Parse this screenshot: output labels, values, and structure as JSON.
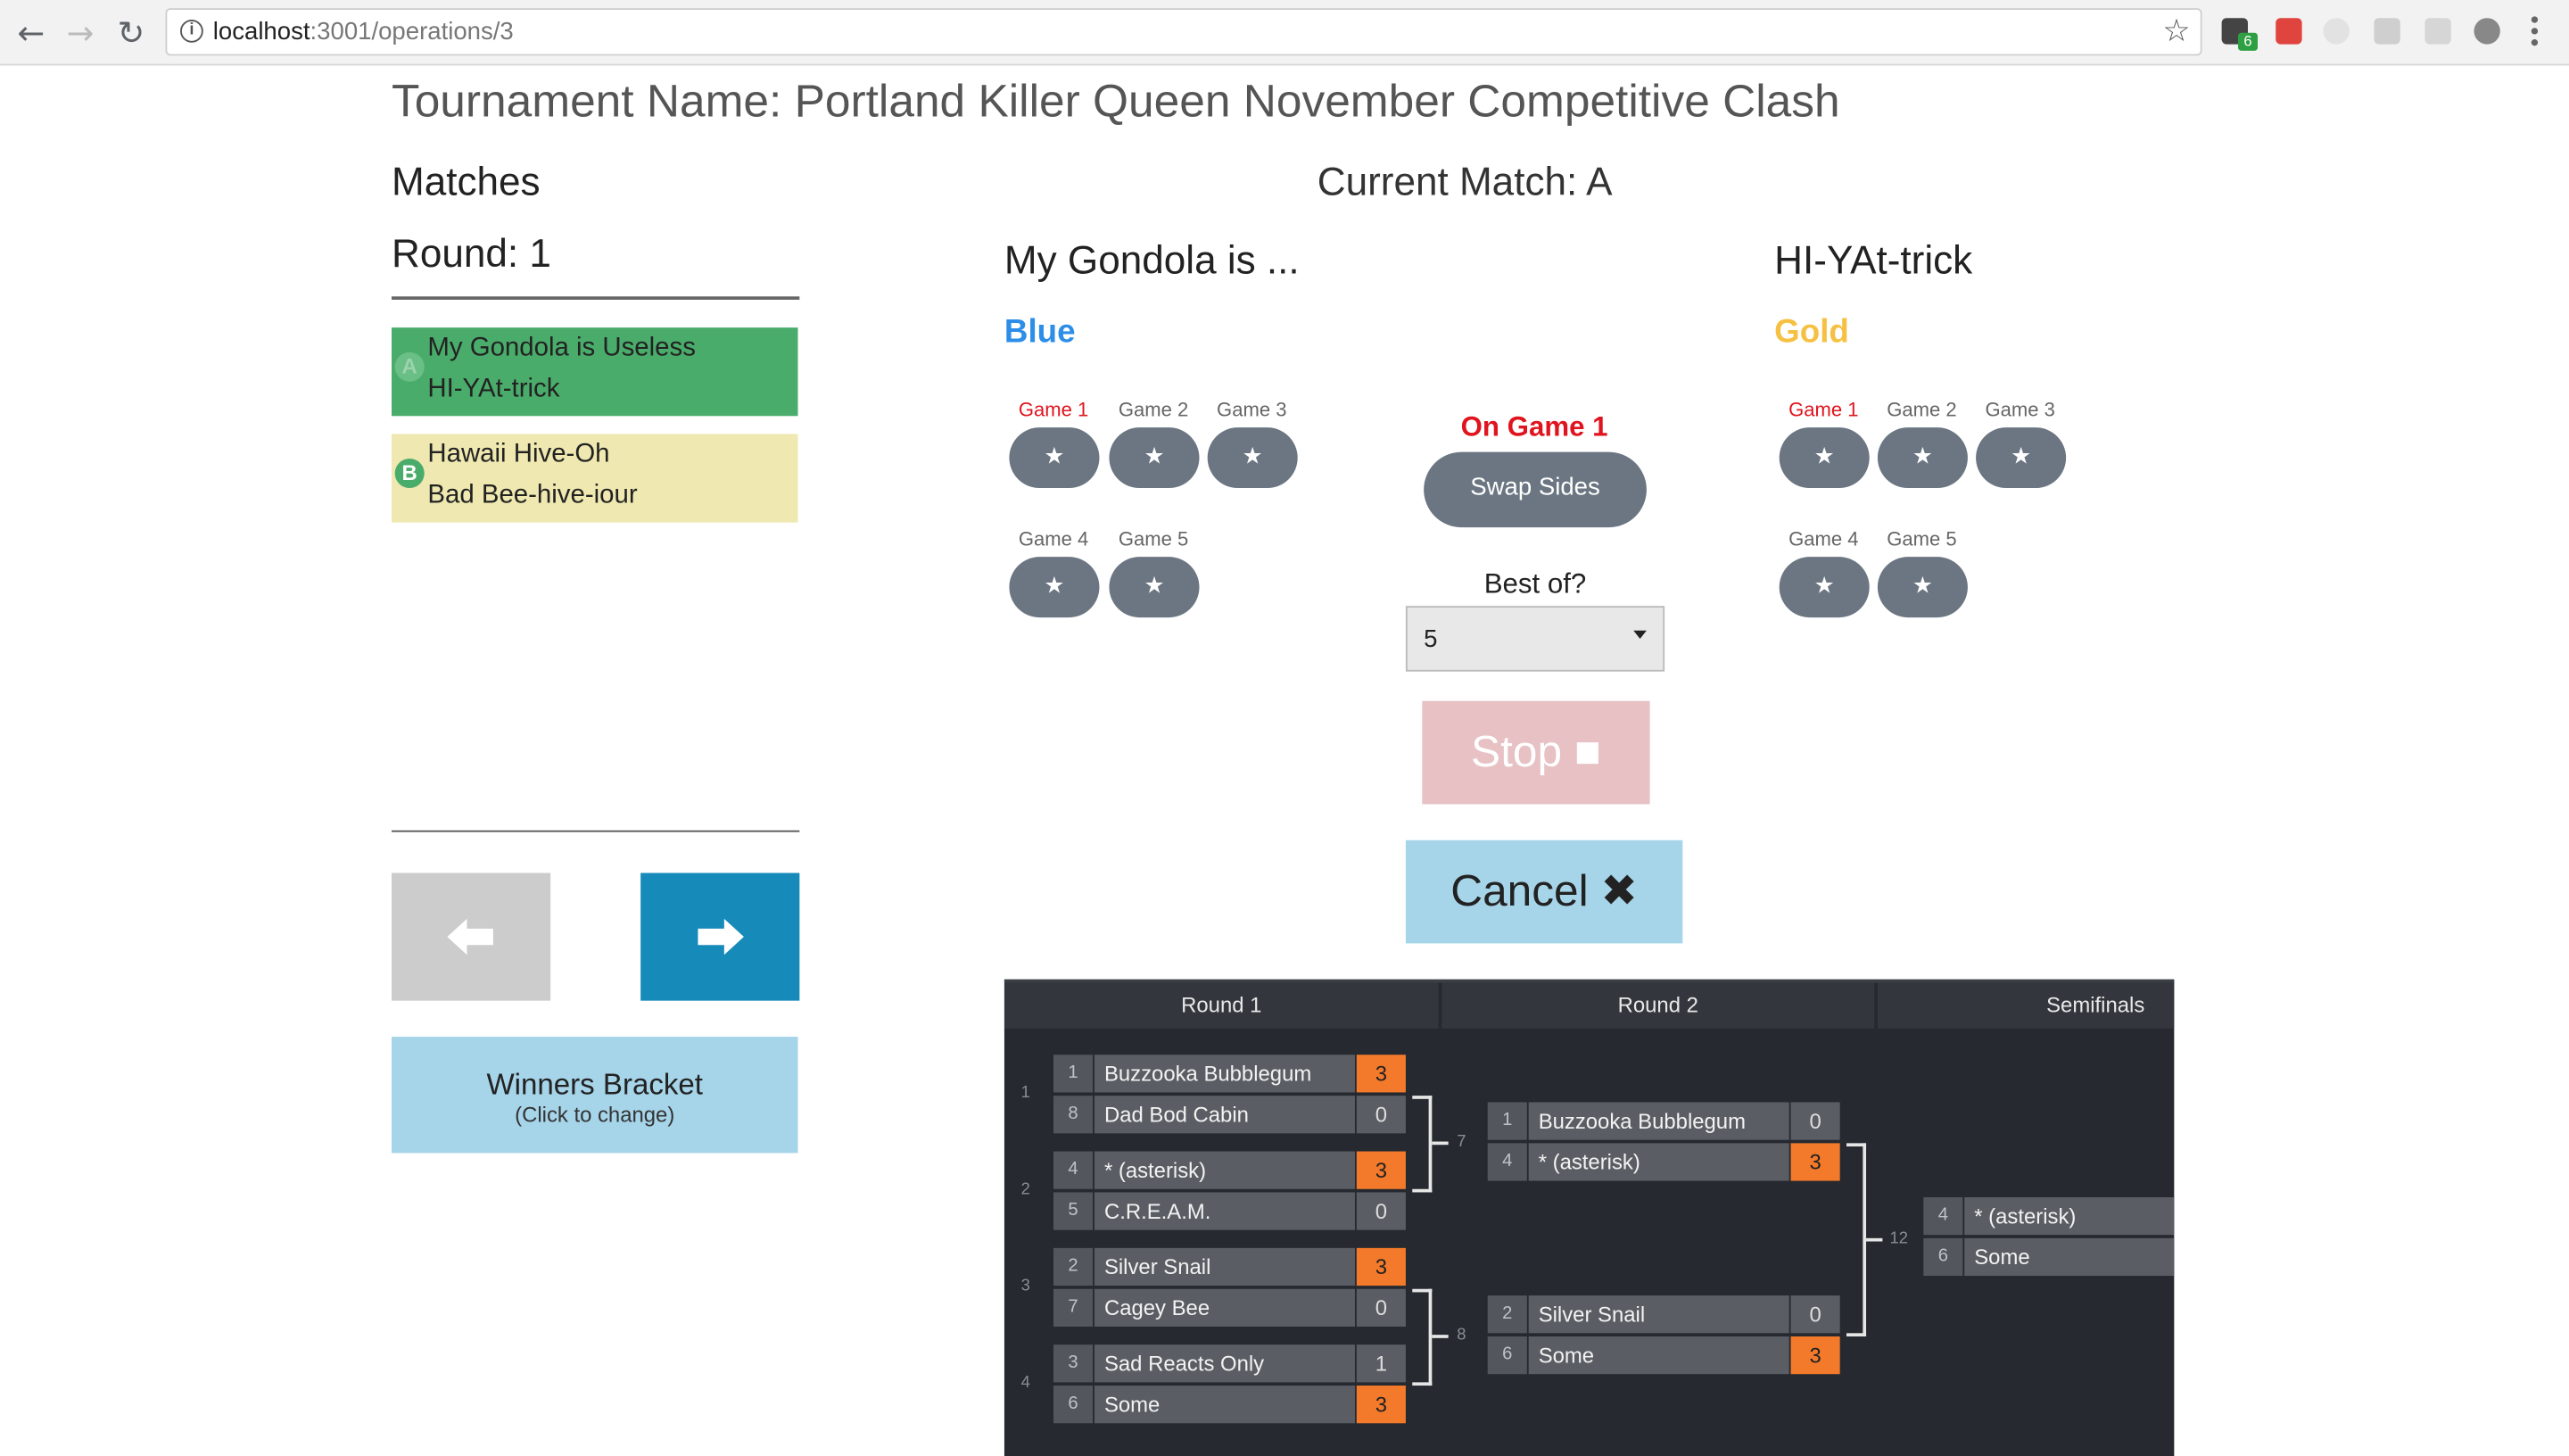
{
  "browser": {
    "url_host": "localhost",
    "url_path": ":3001/operations/3",
    "back_icon": "arrow-left-icon",
    "forward_icon": "arrow-right-icon",
    "reload_icon": "reload-icon",
    "info_icon": "info-icon",
    "star_icon": "star-icon",
    "extension_badge": "6"
  },
  "page": {
    "title": "Tournament Name: Portland Killer Queen November Competitive Clash"
  },
  "sidebar": {
    "heading": "Matches",
    "round": "Round: 1",
    "matches": [
      {
        "letter": "A",
        "team1": "My Gondola is Useless",
        "team2": "HI-YAt-trick",
        "color": "#4aac6b"
      },
      {
        "letter": "B",
        "team1": "Hawaii Hive-Oh",
        "team2": "Bad Bee-hive-iour",
        "color": "#efe8b0"
      }
    ],
    "prev_icon": "arrow-left-icon",
    "next_icon": "arrow-right-icon",
    "bracket_button": {
      "label": "Winners Bracket",
      "sublabel": "(Click to change)"
    }
  },
  "current": {
    "heading": "Current Match: A",
    "blue_team": {
      "name": "My Gondola is ...",
      "side": "Blue",
      "side_color": "#2d8ee8"
    },
    "gold_team": {
      "name": "HI-YAt-trick",
      "side": "Gold",
      "side_color": "#f6c142"
    },
    "games": [
      "Game 1",
      "Game 2",
      "Game 3",
      "Game 4",
      "Game 5"
    ],
    "active_game_index": 0,
    "star": "★",
    "on_game": "On Game 1",
    "swap_label": "Swap Sides",
    "best_of_label": "Best of?",
    "best_of_value": "5",
    "stop_label": "Stop ■",
    "cancel_label": "Cancel ✖"
  },
  "bracket": {
    "rounds": [
      "Round 1",
      "Round 2",
      "Semifinals"
    ],
    "round1": [
      {
        "num": "1",
        "teams": [
          {
            "seed": "1",
            "name": "Buzzooka Bubblegum",
            "score": "3",
            "win": true
          },
          {
            "seed": "8",
            "name": "Dad Bod Cabin",
            "score": "0",
            "win": false
          }
        ]
      },
      {
        "num": "2",
        "teams": [
          {
            "seed": "4",
            "name": "* (asterisk)",
            "score": "3",
            "win": true
          },
          {
            "seed": "5",
            "name": "C.R.E.A.M.",
            "score": "0",
            "win": false
          }
        ]
      },
      {
        "num": "3",
        "teams": [
          {
            "seed": "2",
            "name": "Silver Snail",
            "score": "3",
            "win": true
          },
          {
            "seed": "7",
            "name": "Cagey Bee",
            "score": "0",
            "win": false
          }
        ]
      },
      {
        "num": "4",
        "teams": [
          {
            "seed": "3",
            "name": "Sad Reacts Only",
            "score": "1",
            "win": false
          },
          {
            "seed": "6",
            "name": "Some",
            "score": "3",
            "win": true
          }
        ]
      }
    ],
    "round2": [
      {
        "num": "7",
        "teams": [
          {
            "seed": "1",
            "name": "Buzzooka Bubblegum",
            "score": "0",
            "win": false
          },
          {
            "seed": "4",
            "name": "* (asterisk)",
            "score": "3",
            "win": true
          }
        ]
      },
      {
        "num": "8",
        "teams": [
          {
            "seed": "2",
            "name": "Silver Snail",
            "score": "0",
            "win": false
          },
          {
            "seed": "6",
            "name": "Some",
            "score": "3",
            "win": true
          }
        ]
      }
    ],
    "semis": [
      {
        "num": "12",
        "teams": [
          {
            "seed": "4",
            "name": "* (asterisk)"
          },
          {
            "seed": "6",
            "name": "Some"
          }
        ]
      }
    ]
  }
}
